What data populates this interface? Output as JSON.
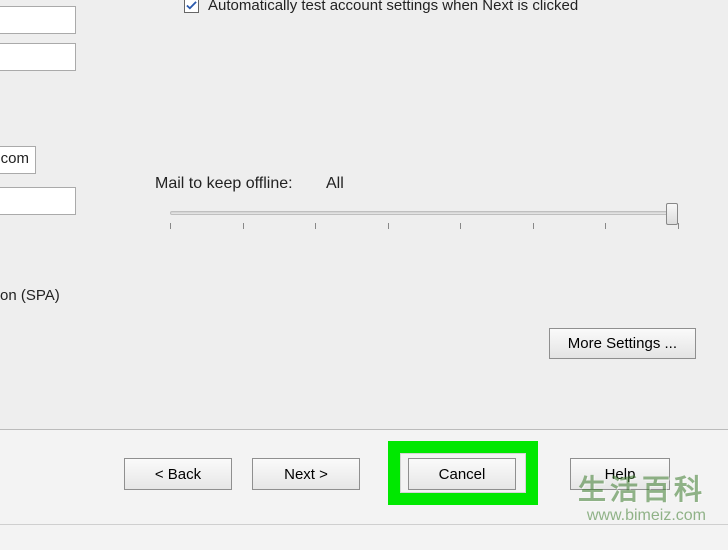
{
  "checkbox": {
    "checked": true,
    "label": "Automatically test account settings when Next is clicked"
  },
  "cropped": {
    "server_suffix": ".com",
    "spa_fragment": "on (SPA)"
  },
  "slider": {
    "label": "Mail to keep offline:",
    "value": "All"
  },
  "buttons": {
    "more_settings": "More Settings ...",
    "back": "< Back",
    "next": "Next >",
    "cancel": "Cancel",
    "help": "Help"
  },
  "watermark": {
    "line1": "生活百科",
    "line2": "www.bimeiz.com"
  }
}
